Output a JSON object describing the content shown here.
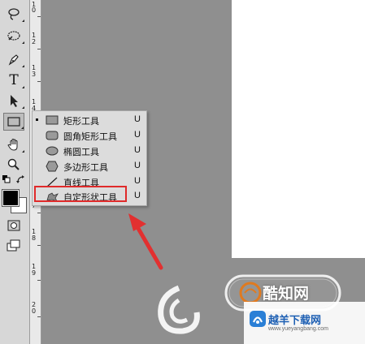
{
  "tools": [
    {
      "icon": "lasso-icon",
      "glyph": ""
    },
    {
      "icon": "quick-select-icon",
      "glyph": ""
    },
    {
      "icon": "pen-icon",
      "glyph": ""
    },
    {
      "icon": "type-icon",
      "glyph": "T"
    },
    {
      "icon": "path-select-icon",
      "glyph": ""
    },
    {
      "icon": "rectangle-tool-icon",
      "glyph": ""
    },
    {
      "icon": "hand-icon",
      "glyph": ""
    },
    {
      "icon": "zoom-icon",
      "glyph": ""
    }
  ],
  "ruler": {
    "labels": [
      "1",
      "0",
      "1",
      "2",
      "1",
      "3",
      "1",
      "4",
      "1",
      "5",
      "1",
      "6",
      "1",
      "7",
      "1",
      "8",
      "1",
      "9",
      "2",
      "0"
    ]
  },
  "shape_menu": {
    "items": [
      {
        "label": "矩形工具",
        "key": "U",
        "icon": "rectangle-shape-icon",
        "active": true
      },
      {
        "label": "圆角矩形工具",
        "key": "U",
        "icon": "rounded-rectangle-shape-icon",
        "active": false
      },
      {
        "label": "椭圆工具",
        "key": "U",
        "icon": "ellipse-shape-icon",
        "active": false
      },
      {
        "label": "多边形工具",
        "key": "U",
        "icon": "polygon-shape-icon",
        "active": false
      },
      {
        "label": "直线工具",
        "key": "U",
        "icon": "line-shape-icon",
        "active": false
      },
      {
        "label": "自定形状工具",
        "key": "U",
        "icon": "custom-shape-icon",
        "active": false
      }
    ]
  },
  "annotation": {
    "color": "#e02a2a"
  },
  "colors": {
    "foreground": "#000000",
    "background": "#ffffff"
  },
  "watermark": {
    "text": "酷知网"
  },
  "footer": {
    "brand": "越羊下载网",
    "url": "www.yueyangbang.com"
  }
}
